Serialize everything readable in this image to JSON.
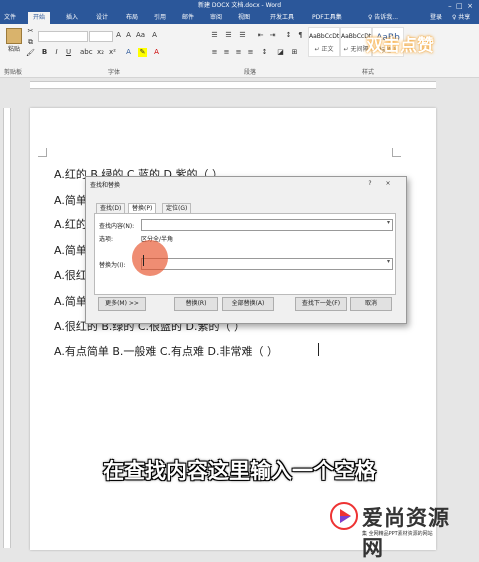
{
  "window": {
    "title": "新建 DOCX 文档.docx - Word"
  },
  "ribbon": {
    "tabs": [
      "文件",
      "开始",
      "插入",
      "设计",
      "布局",
      "引用",
      "邮件",
      "审阅",
      "视图",
      "开发工具",
      "PDF工具集"
    ],
    "active_tab": "开始",
    "tell_me": "♀ 告诉我...",
    "login": "登录",
    "share": "♀ 共享",
    "groups": {
      "clipboard": "剪贴板",
      "font": "字体",
      "paragraph": "段落",
      "styles": "样式"
    },
    "paste_label": "粘贴",
    "styles": [
      "AaBbCcDt",
      "AaBbCcDt",
      "AaBb"
    ],
    "style_names": [
      "↵ 正文",
      "↵ 无间隔",
      "标题 1"
    ]
  },
  "overlay_top": "双击点赞",
  "document": {
    "lines": [
      "A.红的  B.绿的  C.蓝的  D.紫的（  ）",
      "A.简单",
      "A.红的",
      "A.简单",
      "A.很红",
      "A.简单",
      "A.很红的  B.绿的  C.很蓝的  D.紫的（  ）",
      "A.有点简单  B.一般难  C.有点难  D.非常难（  ）"
    ]
  },
  "dialog": {
    "title": "查找和替换",
    "help": "?",
    "close": "×",
    "tabs": [
      "查找(D)",
      "替换(P)",
      "定位(G)"
    ],
    "active_tab": "替换(P)",
    "find_label": "查找内容(N):",
    "options_label": "选项:",
    "options_value": "区分全/半角",
    "replace_label": "替换为(I):",
    "buttons": {
      "more": "更多(M) >>",
      "replace": "替换(R)",
      "replace_all": "全部替换(A)",
      "find_next": "查找下一处(F)",
      "cancel": "取消"
    }
  },
  "subtitle": "在查找内容这里输入一个空格",
  "logo": {
    "name": "爱尚资源网",
    "tagline": "集 全网精品PPT素材资源的网站"
  }
}
